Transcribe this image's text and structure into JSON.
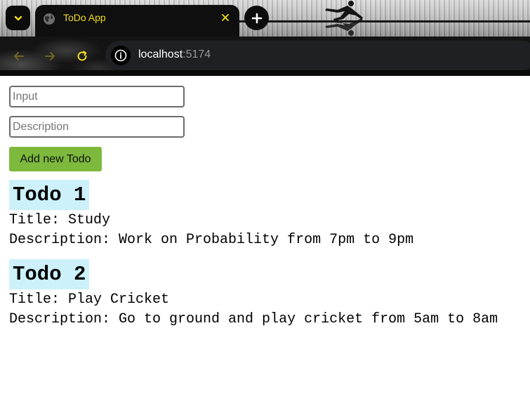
{
  "browser": {
    "tab": {
      "title": "ToDo App"
    },
    "address": {
      "host": "localhost",
      "port": ":5174"
    },
    "accent_color": "#f2dd1a"
  },
  "icons": {
    "tab_menu": "chevron-down-icon",
    "favicon": "globe-icon",
    "close": "close-icon",
    "new_tab": "plus-icon",
    "back": "arrow-left-icon",
    "forward": "arrow-right-icon",
    "reload": "reload-icon",
    "site_info": "info-icon"
  },
  "form": {
    "title_placeholder": "Input",
    "title_value": "",
    "description_placeholder": "Description",
    "description_value": "",
    "add_button_label": "Add new Todo",
    "add_button_color": "#7cb93c"
  },
  "todos": [
    {
      "heading": "Todo 1",
      "title": "Title: Study",
      "description": "Description: Work on Probability from 7pm to 9pm"
    },
    {
      "heading": "Todo 2",
      "title": "Title: Play Cricket",
      "description": "Description: Go to ground and play cricket from 5am to 8am"
    }
  ],
  "heading_bg_color": "#cdf1fa"
}
